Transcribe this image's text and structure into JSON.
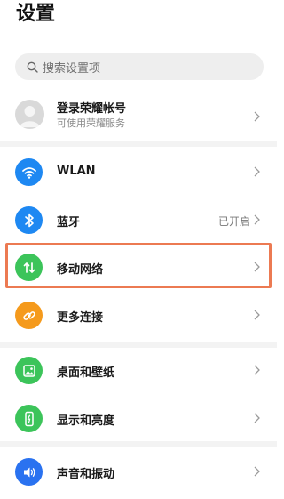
{
  "header": {
    "title": "设置"
  },
  "search": {
    "placeholder": "搜索设置项"
  },
  "account": {
    "title": "登录荣耀帐号",
    "subtitle": "可使用荣耀服务"
  },
  "items": [
    {
      "label": "WLAN",
      "icon": "wifi-icon",
      "color": "#1e88f2"
    },
    {
      "label": "蓝牙",
      "icon": "bluetooth-icon",
      "color": "#1e88f2",
      "status": "已开启"
    },
    {
      "label": "移动网络",
      "icon": "mobile-data-icon",
      "color": "#3cc45a"
    },
    {
      "label": "更多连接",
      "icon": "link-icon",
      "color": "#f59a1c"
    },
    {
      "label": "桌面和壁纸",
      "icon": "wallpaper-icon",
      "color": "#3cc45a"
    },
    {
      "label": "显示和亮度",
      "icon": "display-icon",
      "color": "#3cc45a"
    },
    {
      "label": "声音和振动",
      "icon": "sound-icon",
      "color": "#2a72f0"
    }
  ],
  "highlight": {
    "color": "#ec7a52"
  }
}
